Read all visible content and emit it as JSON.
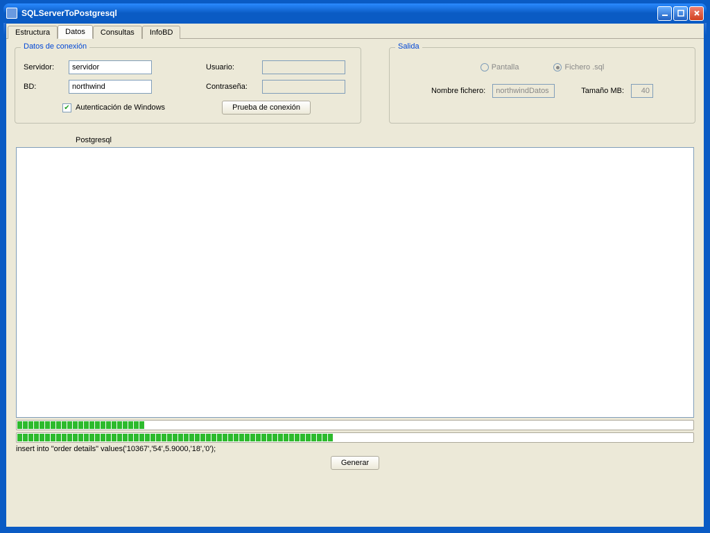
{
  "window": {
    "title": "SQLServerToPostgresql"
  },
  "tabs": [
    "Estructura",
    "Datos",
    "Consultas",
    "InfoBD"
  ],
  "active_tab": 1,
  "conn": {
    "legend": "Datos de conexión",
    "servidor_label": "Servidor:",
    "servidor_value": "servidor",
    "bd_label": "BD:",
    "bd_value": "northwind",
    "usuario_label": "Usuario:",
    "usuario_value": "",
    "contrasena_label": "Contraseña:",
    "contrasena_value": "",
    "auth_checkbox_label": "Autenticación de Windows",
    "auth_checked": true,
    "test_btn": "Prueba de conexión"
  },
  "salida": {
    "legend": "Salida",
    "pantalla_label": "Pantalla",
    "fichero_label": "Fichero .sql",
    "nombre_label": "Nombre fichero:",
    "nombre_value": "northwindDatos",
    "tamano_label": "Tamaño MB:",
    "tamano_value": "40"
  },
  "main": {
    "postgres_label": "Postgresql",
    "progress1_pct": 19,
    "progress2_pct": 47,
    "status_text": "insert into \"order details\" values('10367','54',5.9000,'18','0');",
    "generar_btn": "Generar"
  }
}
